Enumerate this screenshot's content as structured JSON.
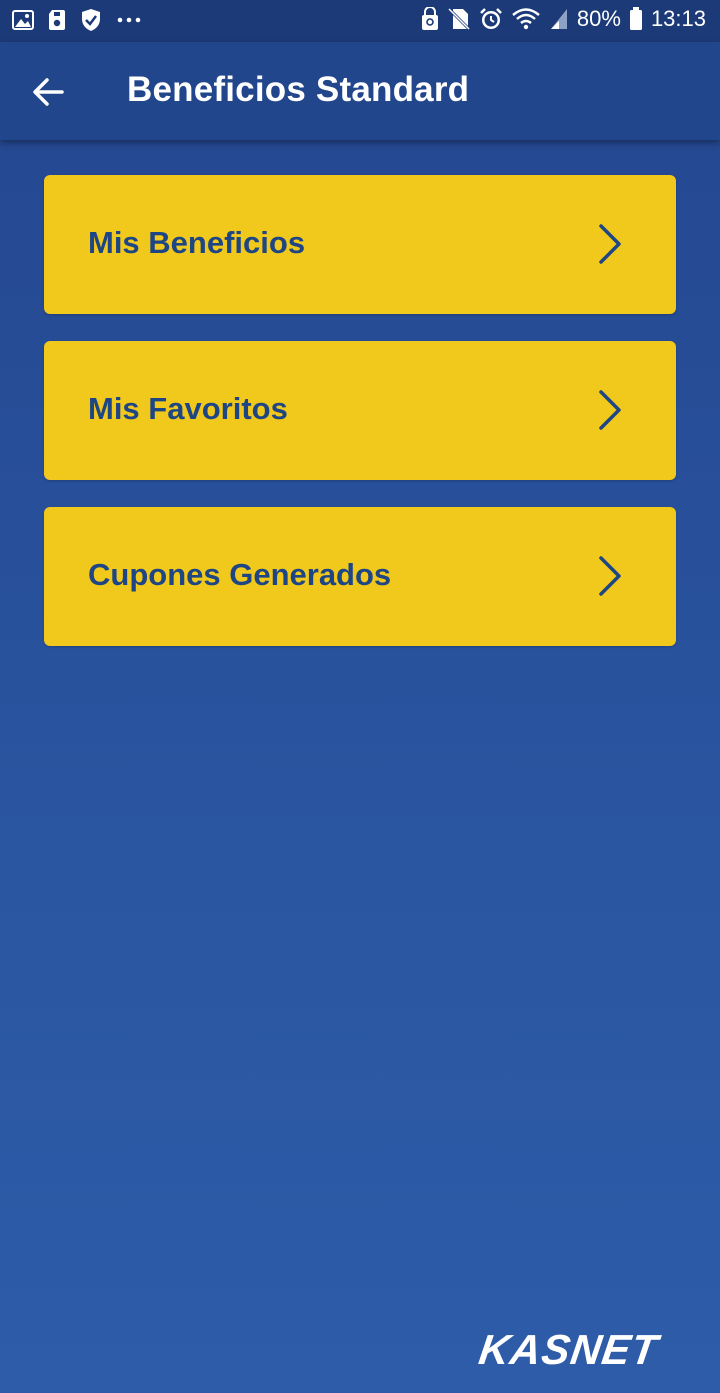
{
  "status_bar": {
    "battery": "80%",
    "time": "13:13",
    "left_icons": [
      "image-icon",
      "sd-card-icon",
      "shield-icon",
      "more-dots-icon"
    ],
    "right_icons": [
      "sync-lock-icon",
      "no-sim-icon",
      "alarm-icon",
      "wifi-icon",
      "signal-icon",
      "battery-icon"
    ]
  },
  "app_bar": {
    "back_icon": "arrow-left-icon",
    "title": "Beneficios Standard"
  },
  "menu": {
    "items": [
      {
        "label": "Mis Beneficios",
        "icon": "chevron-right-icon"
      },
      {
        "label": "Mis Favoritos",
        "icon": "chevron-right-icon"
      },
      {
        "label": "Cupones Generados",
        "icon": "chevron-right-icon"
      }
    ]
  },
  "brand": {
    "logo_text": "KASNET"
  },
  "colors": {
    "status_bar_bg": "#1c3a78",
    "app_bar_bg": "#21468c",
    "background": "#2a55a0",
    "card_yellow": "#f1c81c",
    "card_text": "#1f4684",
    "white": "#ffffff"
  }
}
